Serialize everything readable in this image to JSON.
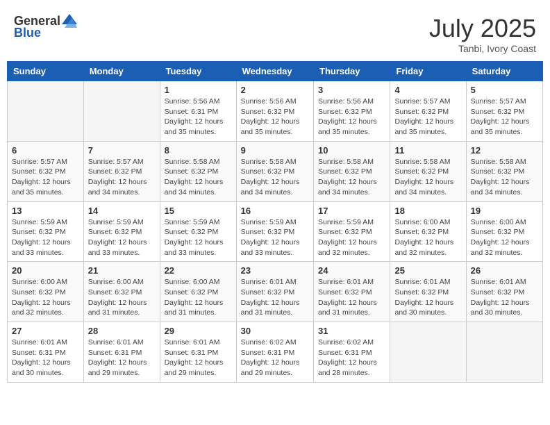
{
  "header": {
    "logo_general": "General",
    "logo_blue": "Blue",
    "month_year": "July 2025",
    "location": "Tanbi, Ivory Coast"
  },
  "weekdays": [
    "Sunday",
    "Monday",
    "Tuesday",
    "Wednesday",
    "Thursday",
    "Friday",
    "Saturday"
  ],
  "weeks": [
    [
      {
        "day": "",
        "info": ""
      },
      {
        "day": "",
        "info": ""
      },
      {
        "day": "1",
        "info": "Sunrise: 5:56 AM\nSunset: 6:31 PM\nDaylight: 12 hours and 35 minutes."
      },
      {
        "day": "2",
        "info": "Sunrise: 5:56 AM\nSunset: 6:32 PM\nDaylight: 12 hours and 35 minutes."
      },
      {
        "day": "3",
        "info": "Sunrise: 5:56 AM\nSunset: 6:32 PM\nDaylight: 12 hours and 35 minutes."
      },
      {
        "day": "4",
        "info": "Sunrise: 5:57 AM\nSunset: 6:32 PM\nDaylight: 12 hours and 35 minutes."
      },
      {
        "day": "5",
        "info": "Sunrise: 5:57 AM\nSunset: 6:32 PM\nDaylight: 12 hours and 35 minutes."
      }
    ],
    [
      {
        "day": "6",
        "info": "Sunrise: 5:57 AM\nSunset: 6:32 PM\nDaylight: 12 hours and 35 minutes."
      },
      {
        "day": "7",
        "info": "Sunrise: 5:57 AM\nSunset: 6:32 PM\nDaylight: 12 hours and 34 minutes."
      },
      {
        "day": "8",
        "info": "Sunrise: 5:58 AM\nSunset: 6:32 PM\nDaylight: 12 hours and 34 minutes."
      },
      {
        "day": "9",
        "info": "Sunrise: 5:58 AM\nSunset: 6:32 PM\nDaylight: 12 hours and 34 minutes."
      },
      {
        "day": "10",
        "info": "Sunrise: 5:58 AM\nSunset: 6:32 PM\nDaylight: 12 hours and 34 minutes."
      },
      {
        "day": "11",
        "info": "Sunrise: 5:58 AM\nSunset: 6:32 PM\nDaylight: 12 hours and 34 minutes."
      },
      {
        "day": "12",
        "info": "Sunrise: 5:58 AM\nSunset: 6:32 PM\nDaylight: 12 hours and 34 minutes."
      }
    ],
    [
      {
        "day": "13",
        "info": "Sunrise: 5:59 AM\nSunset: 6:32 PM\nDaylight: 12 hours and 33 minutes."
      },
      {
        "day": "14",
        "info": "Sunrise: 5:59 AM\nSunset: 6:32 PM\nDaylight: 12 hours and 33 minutes."
      },
      {
        "day": "15",
        "info": "Sunrise: 5:59 AM\nSunset: 6:32 PM\nDaylight: 12 hours and 33 minutes."
      },
      {
        "day": "16",
        "info": "Sunrise: 5:59 AM\nSunset: 6:32 PM\nDaylight: 12 hours and 33 minutes."
      },
      {
        "day": "17",
        "info": "Sunrise: 5:59 AM\nSunset: 6:32 PM\nDaylight: 12 hours and 32 minutes."
      },
      {
        "day": "18",
        "info": "Sunrise: 6:00 AM\nSunset: 6:32 PM\nDaylight: 12 hours and 32 minutes."
      },
      {
        "day": "19",
        "info": "Sunrise: 6:00 AM\nSunset: 6:32 PM\nDaylight: 12 hours and 32 minutes."
      }
    ],
    [
      {
        "day": "20",
        "info": "Sunrise: 6:00 AM\nSunset: 6:32 PM\nDaylight: 12 hours and 32 minutes."
      },
      {
        "day": "21",
        "info": "Sunrise: 6:00 AM\nSunset: 6:32 PM\nDaylight: 12 hours and 31 minutes."
      },
      {
        "day": "22",
        "info": "Sunrise: 6:00 AM\nSunset: 6:32 PM\nDaylight: 12 hours and 31 minutes."
      },
      {
        "day": "23",
        "info": "Sunrise: 6:01 AM\nSunset: 6:32 PM\nDaylight: 12 hours and 31 minutes."
      },
      {
        "day": "24",
        "info": "Sunrise: 6:01 AM\nSunset: 6:32 PM\nDaylight: 12 hours and 31 minutes."
      },
      {
        "day": "25",
        "info": "Sunrise: 6:01 AM\nSunset: 6:32 PM\nDaylight: 12 hours and 30 minutes."
      },
      {
        "day": "26",
        "info": "Sunrise: 6:01 AM\nSunset: 6:32 PM\nDaylight: 12 hours and 30 minutes."
      }
    ],
    [
      {
        "day": "27",
        "info": "Sunrise: 6:01 AM\nSunset: 6:31 PM\nDaylight: 12 hours and 30 minutes."
      },
      {
        "day": "28",
        "info": "Sunrise: 6:01 AM\nSunset: 6:31 PM\nDaylight: 12 hours and 29 minutes."
      },
      {
        "day": "29",
        "info": "Sunrise: 6:01 AM\nSunset: 6:31 PM\nDaylight: 12 hours and 29 minutes."
      },
      {
        "day": "30",
        "info": "Sunrise: 6:02 AM\nSunset: 6:31 PM\nDaylight: 12 hours and 29 minutes."
      },
      {
        "day": "31",
        "info": "Sunrise: 6:02 AM\nSunset: 6:31 PM\nDaylight: 12 hours and 28 minutes."
      },
      {
        "day": "",
        "info": ""
      },
      {
        "day": "",
        "info": ""
      }
    ]
  ]
}
